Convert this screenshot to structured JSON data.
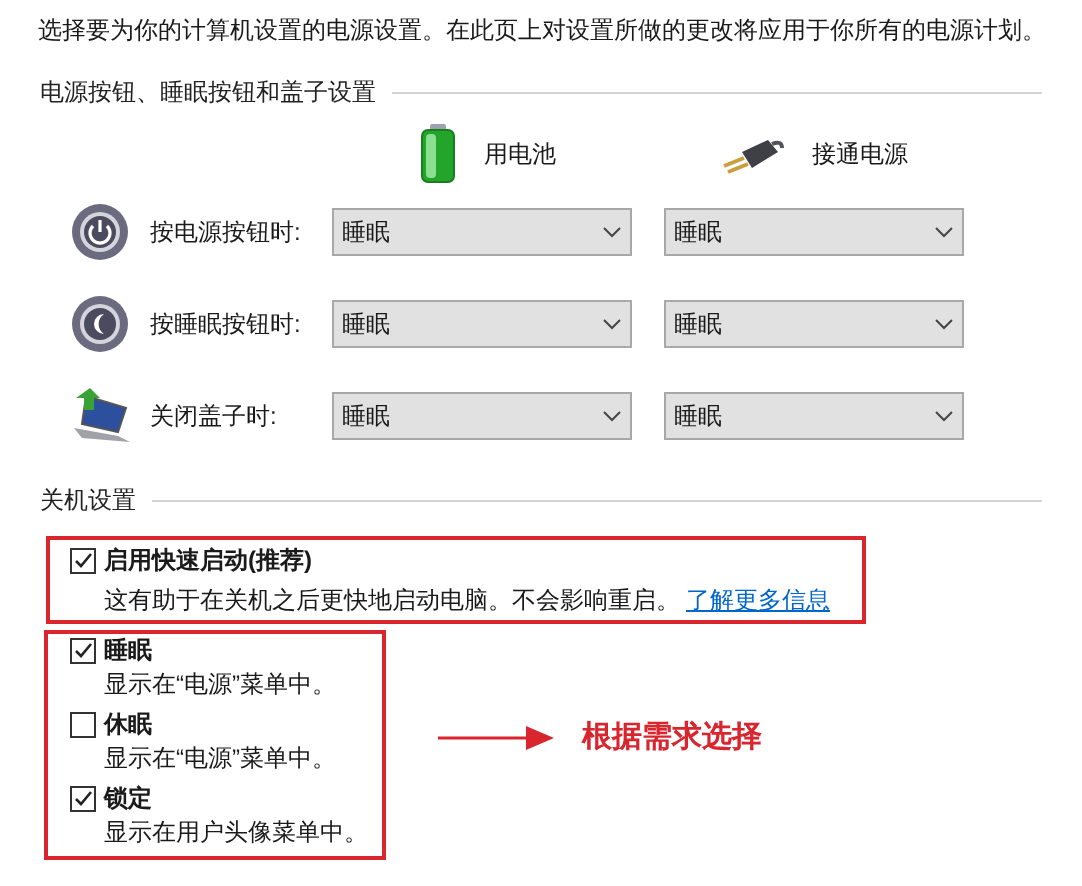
{
  "intro": "选择要为你的计算机设置的电源设置。在此页上对设置所做的更改将应用于你所有的电源计划。",
  "buttons_section": {
    "title": "电源按钮、睡眠按钮和盖子设置",
    "columns": [
      {
        "kind": "battery",
        "label": "用电池"
      },
      {
        "kind": "plug",
        "label": "接通电源"
      }
    ],
    "rows": [
      {
        "kind": "power",
        "label": "按电源按钮时:",
        "values": [
          "睡眠",
          "睡眠"
        ]
      },
      {
        "kind": "sleep",
        "label": "按睡眠按钮时:",
        "values": [
          "睡眠",
          "睡眠"
        ]
      },
      {
        "kind": "lid",
        "label": "关闭盖子时:",
        "values": [
          "睡眠",
          "睡眠"
        ]
      }
    ]
  },
  "shutdown_section": {
    "title": "关机设置",
    "fast_startup": {
      "label": "启用快速启动(推荐)",
      "checked": true,
      "description": "这有助于在关机之后更快地启动电脑。不会影响重启。",
      "link": "了解更多信息"
    },
    "menu_items": [
      {
        "label": "睡眠",
        "checked": true,
        "description": "显示在“电源”菜单中。"
      },
      {
        "label": "休眠",
        "checked": false,
        "description": "显示在“电源”菜单中。"
      },
      {
        "label": "锁定",
        "checked": true,
        "description": "显示在用户头像菜单中。"
      }
    ]
  },
  "annotation": "根据需求选择"
}
